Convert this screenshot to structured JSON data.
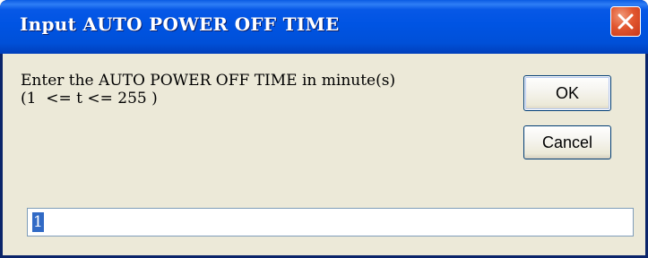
{
  "dialog": {
    "title": "Input AUTO POWER OFF TIME",
    "prompt_line1": "Enter the AUTO POWER OFF TIME in minute(s)",
    "prompt_line2": "(1  <= t <= 255 )",
    "ok_label": "OK",
    "cancel_label": "Cancel",
    "input_value": "1",
    "close_icon": "close-icon"
  },
  "colors": {
    "titlebar": "#0054e3",
    "close_button": "#e2572f",
    "client_background": "#ece9d8",
    "selection": "#316ac5"
  }
}
